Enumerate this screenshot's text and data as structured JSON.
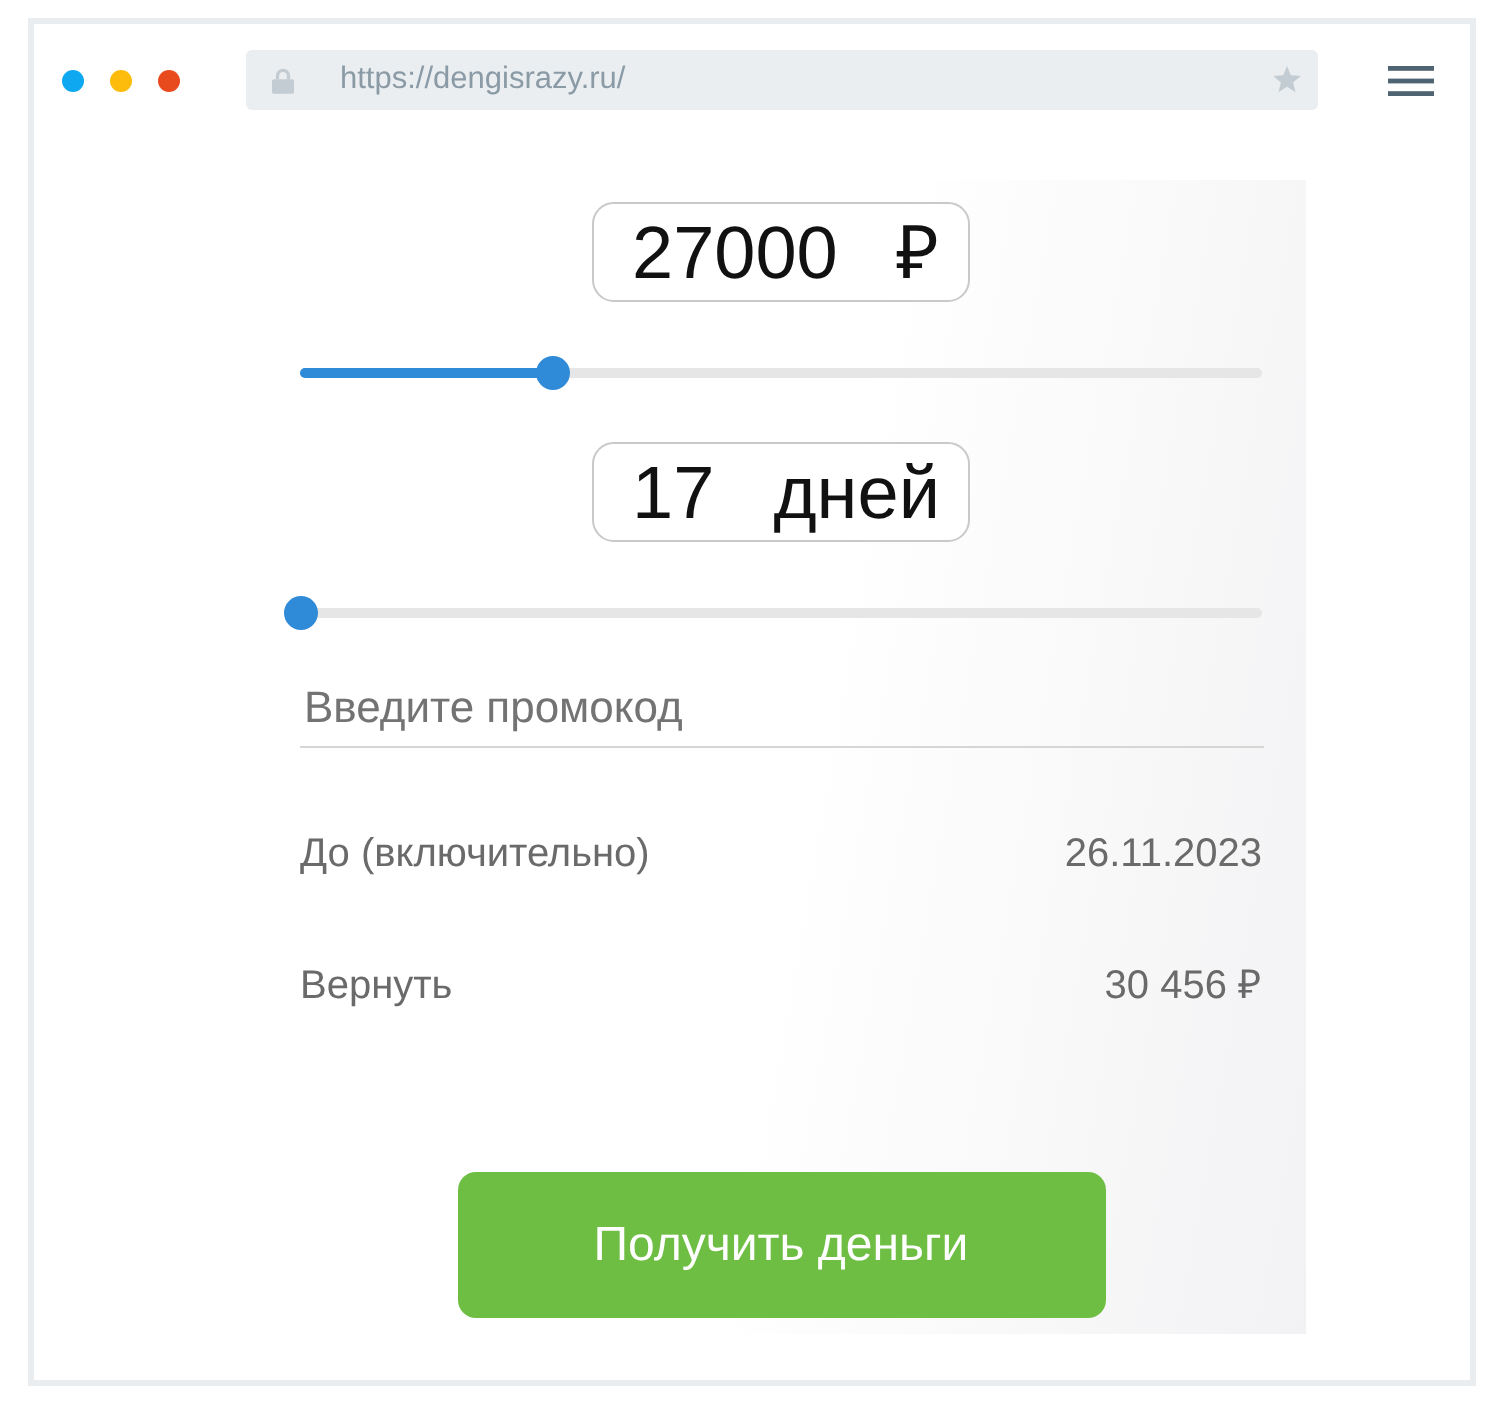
{
  "browser": {
    "window_dots": [
      {
        "color": "#0ea8f0"
      },
      {
        "color": "#fdbb0b"
      },
      {
        "color": "#e84a1d"
      }
    ],
    "url": "https://dengisrazy.ru/"
  },
  "calculator": {
    "amount": {
      "value": "27000",
      "unit": "₽",
      "level": 0.262
    },
    "term": {
      "value": "17",
      "unit": "дней",
      "level": 0
    },
    "promo": {
      "placeholder": "Введите промокод"
    },
    "summary": [
      {
        "label": "До (включительно)",
        "value": "26.11.2023"
      },
      {
        "label": "Вернуть",
        "value": "30 456 ₽"
      }
    ],
    "submit": "Получить деньги"
  }
}
